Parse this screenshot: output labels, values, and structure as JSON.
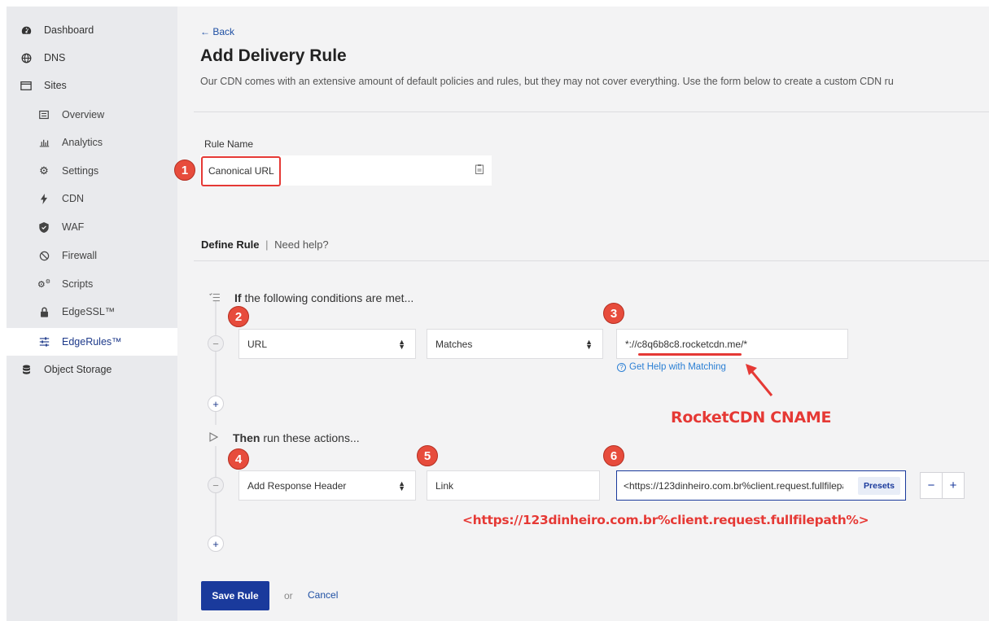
{
  "sidebar": {
    "items": [
      {
        "label": "Dashboard",
        "icon": "dashboard-icon"
      },
      {
        "label": "DNS",
        "icon": "globe-icon"
      },
      {
        "label": "Sites",
        "icon": "window-icon"
      },
      {
        "label": "Overview",
        "icon": "list-icon"
      },
      {
        "label": "Analytics",
        "icon": "bar-chart-icon"
      },
      {
        "label": "Settings",
        "icon": "gear-icon"
      },
      {
        "label": "CDN",
        "icon": "bolt-icon"
      },
      {
        "label": "WAF",
        "icon": "shield-icon"
      },
      {
        "label": "Firewall",
        "icon": "ban-icon"
      },
      {
        "label": "Scripts",
        "icon": "cogs-icon"
      },
      {
        "label": "EdgeSSL™",
        "icon": "lock-icon"
      },
      {
        "label": "EdgeRules™",
        "icon": "sliders-icon"
      },
      {
        "label": "Object Storage",
        "icon": "database-icon"
      }
    ],
    "active": "EdgeRules™"
  },
  "header": {
    "back": "← Back",
    "title": "Add Delivery Rule",
    "description": "Our CDN comes with an extensive amount of default policies and rules, but they may not cover everything. Use the form below to create a custom CDN ru"
  },
  "rule_name": {
    "label": "Rule Name",
    "value": "Canonical URL"
  },
  "define_rule": {
    "title": "Define Rule",
    "separator": "|",
    "help": "Need help?"
  },
  "conditions": {
    "heading_bold": "If",
    "heading_rest": "the following conditions are met...",
    "field": "URL",
    "operator": "Matches",
    "value": "*://c8q6b8c8.rocketcdn.me/*",
    "help_link": "Get Help with Matching"
  },
  "actions": {
    "heading_bold": "Then",
    "heading_rest": "run these actions...",
    "action": "Add Response Header",
    "header_name": "Link",
    "header_value": "<https://123dinheiro.com.br%client.request.fullfilepath%>",
    "presets": "Presets"
  },
  "footer": {
    "save": "Save Rule",
    "or": "or",
    "cancel": "Cancel"
  },
  "annotations": {
    "badges": [
      "1",
      "2",
      "3",
      "4",
      "5",
      "6"
    ],
    "cname_label": "RocketCDN CNAME",
    "header_label": "<https://123dinheiro.com.br%client.request.fullfilepath%>"
  },
  "colors": {
    "accent": "#1a3a9c",
    "annotation": "#e53935",
    "sidebar_bg": "#e9eaed",
    "main_bg": "#f3f3f4"
  }
}
